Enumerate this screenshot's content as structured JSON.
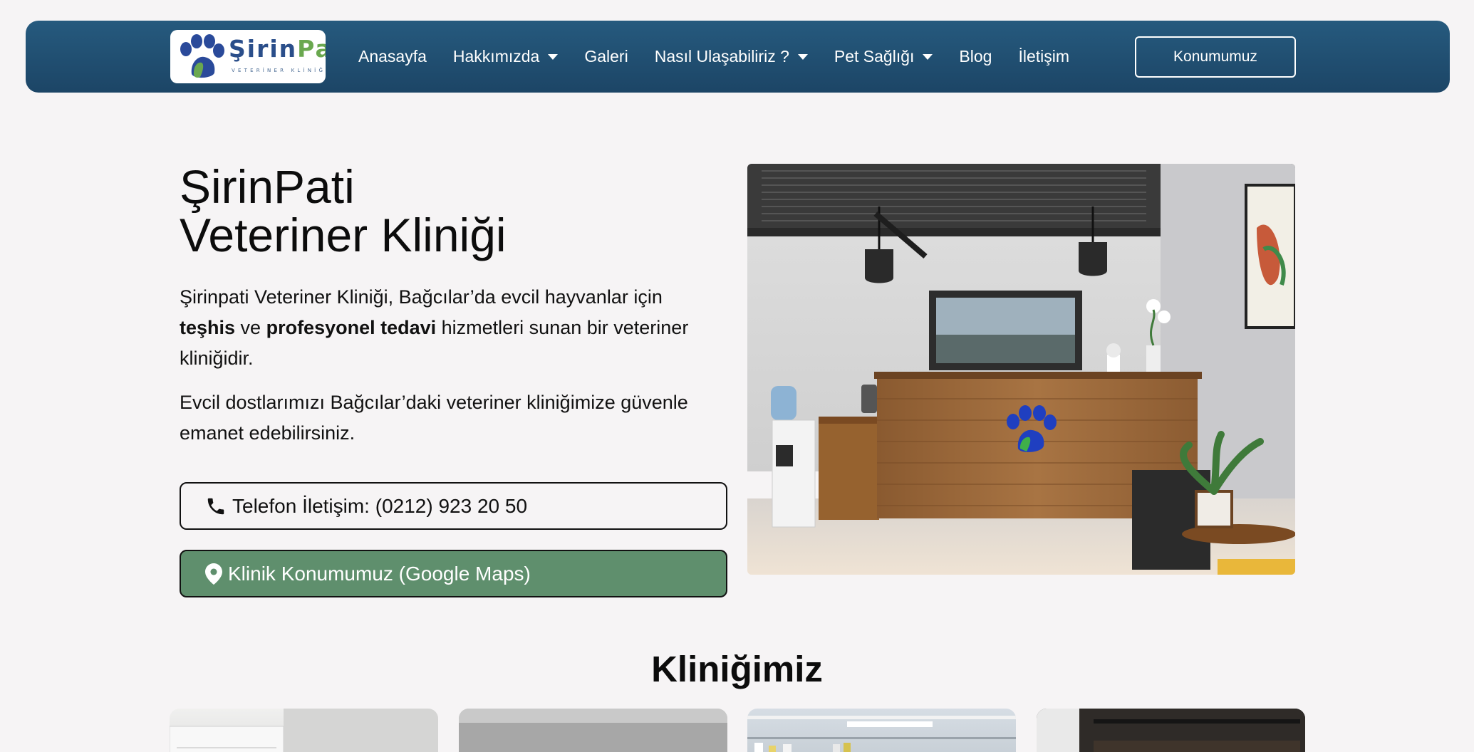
{
  "header": {
    "logo": {
      "word1": "Şirin",
      "word2": "Pati",
      "subtitle": "VETERİNER KLİNİĞİ"
    },
    "nav": [
      {
        "label": "Anasayfa",
        "dropdown": false
      },
      {
        "label": "Hakkımızda",
        "dropdown": true
      },
      {
        "label": "Galeri",
        "dropdown": false
      },
      {
        "label": "Nasıl Ulaşabiliriz ?",
        "dropdown": true
      },
      {
        "label": "Pet Sağlığı",
        "dropdown": true
      },
      {
        "label": "Blog",
        "dropdown": false
      },
      {
        "label": "İletişim",
        "dropdown": false
      }
    ],
    "cta_label": "Konumumuz"
  },
  "hero": {
    "title_line1": "ŞirinPati",
    "title_line2": "Veteriner Kliniği",
    "p1": {
      "t1": "Şirinpati Veteriner Kliniği, Bağcılar’da evcil hayvanlar için ",
      "b1": "teşhis",
      "t2": " ve ",
      "b2": "profesyonel tedavi",
      "t3": " hizmetleri sunan bir veteriner kliniğidir."
    },
    "p2": "Evcil dostlarımızı Bağcılar’daki veteriner kliniğimize güvenle emanet edebilirsiniz.",
    "phone_button": "Telefon İletişim: (0212) 923 20 50",
    "map_button": "Klinik Konumumuz (Google Maps)",
    "icons": {
      "phone": "phone-icon",
      "map": "map-marker-icon"
    }
  },
  "clinic_section": {
    "title": "Kliniğimiz"
  },
  "colors": {
    "header_top": "#265a7e",
    "header_bottom": "#1c4566",
    "map_button": "#5f8f6d",
    "page_bg": "#f6f4f5"
  }
}
